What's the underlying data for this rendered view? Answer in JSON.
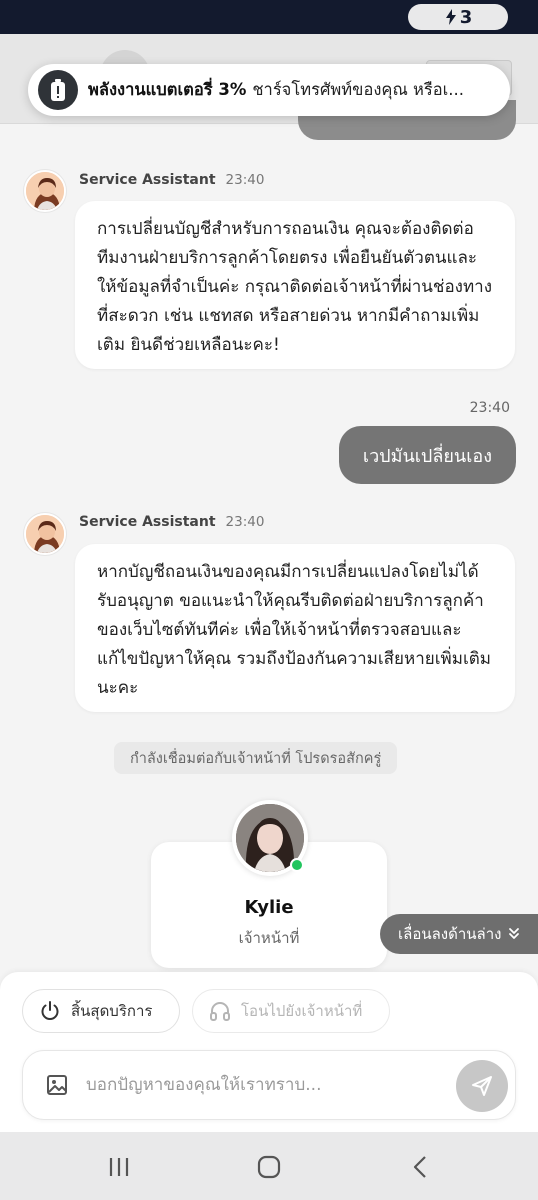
{
  "status_bar": {
    "battery_level": "3",
    "icon": "charging-bolt-icon"
  },
  "notification": {
    "icon": "battery-alert-icon",
    "title": "พลังงานแบตเตอรี่ 3%",
    "body": "ชาร์จโทรศัพท์ของคุณ หรือเ..."
  },
  "messages": [
    {
      "sender": "Service Assistant",
      "time": "23:40",
      "text": "การเปลี่ยนบัญชีสำหรับการถอนเงิน คุณจะต้องติดต่อทีมงานฝ่ายบริการลูกค้าโดยตรง เพื่อยืนยันตัวตนและให้ข้อมูลที่จำเป็นค่ะ กรุณาติดต่อเจ้าหน้าที่ผ่านช่องทางที่สะดวก เช่น แชทสด หรือสายด่วน หากมีคำถามเพิ่มเติม ยินดีช่วยเหลือนะคะ!"
    },
    {
      "time": "23:40",
      "text": "เวปมันเปลี่ยนเอง"
    },
    {
      "sender": "Service Assistant",
      "time": "23:40",
      "text": "หากบัญชีถอนเงินของคุณมีการเปลี่ยนแปลงโดยไม่ได้รับอนุญาต ขอแนะนำให้คุณรีบติดต่อฝ่ายบริการลูกค้าของเว็บไซต์ทันทีค่ะ เพื่อให้เจ้าหน้าที่ตรวจสอบและแก้ไขปัญหาให้คุณ รวมถึงป้องกันความเสียหายเพิ่มเติมนะคะ"
    }
  ],
  "system_note": "กำลังเชื่อมต่อกับเจ้าหน้าที่ โปรดรอสักครู่",
  "agent_card": {
    "name": "Kylie",
    "role": "เจ้าหน้าที่",
    "status_color": "#22c55e"
  },
  "scroll_down": {
    "label": "เลื่อนลงด้านล่าง",
    "icon": "double-chevron-down-icon"
  },
  "actions": {
    "end_service": "สิ้นสุดบริการ",
    "end_icon": "power-icon",
    "transfer_agent": "โอนไปยังเจ้าหน้าที่",
    "transfer_icon": "headphones-icon"
  },
  "composer": {
    "placeholder": "บอกปัญหาของคุณให้เราทราบ...",
    "image_icon": "image-icon",
    "send_icon": "send-icon"
  },
  "nav": {
    "recents_icon": "recents-icon",
    "home_icon": "home-icon",
    "back_icon": "back-icon"
  },
  "colors": {
    "outgoing_bubble": "#757575",
    "status_bar": "#131a2e",
    "send_button": "#c7c7c7"
  }
}
